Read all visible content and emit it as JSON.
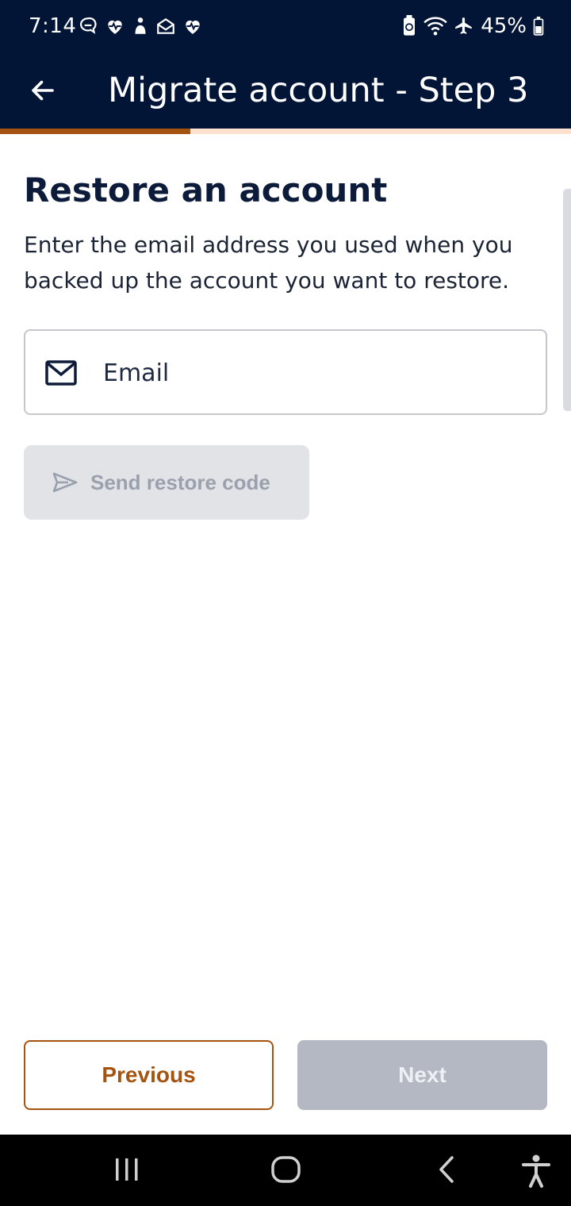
{
  "status_bar": {
    "time": "7:14",
    "battery": "45%",
    "left_icons": [
      "chat-icon",
      "heart-pulse-icon",
      "figure-icon",
      "mail-open-icon",
      "heart-pulse-icon"
    ],
    "right_icons": [
      "recycle-battery-icon",
      "wifi-icon",
      "airplane-icon",
      "battery-icon"
    ]
  },
  "app_bar": {
    "title": "Migrate account - Step 3",
    "back_icon": "arrow-left-icon",
    "background": "#031537"
  },
  "progress": {
    "fraction": 0.333,
    "fill_color": "#a45410",
    "track_color": "#fde0cf"
  },
  "main": {
    "heading": "Restore an account",
    "description": "Enter the email address you used when you backed up the account you want to restore.",
    "email_field": {
      "placeholder": "Email",
      "value": "",
      "icon": "mail-icon"
    },
    "send_button": {
      "label": "Send restore code",
      "icon": "send-icon",
      "enabled": false
    }
  },
  "footer": {
    "previous_label": "Previous",
    "next_label": "Next",
    "next_enabled": false,
    "accent_color": "#a45410"
  },
  "nav_bar": {
    "items": [
      "recent-apps-icon",
      "home-icon",
      "back-icon",
      "accessibility-icon"
    ]
  }
}
